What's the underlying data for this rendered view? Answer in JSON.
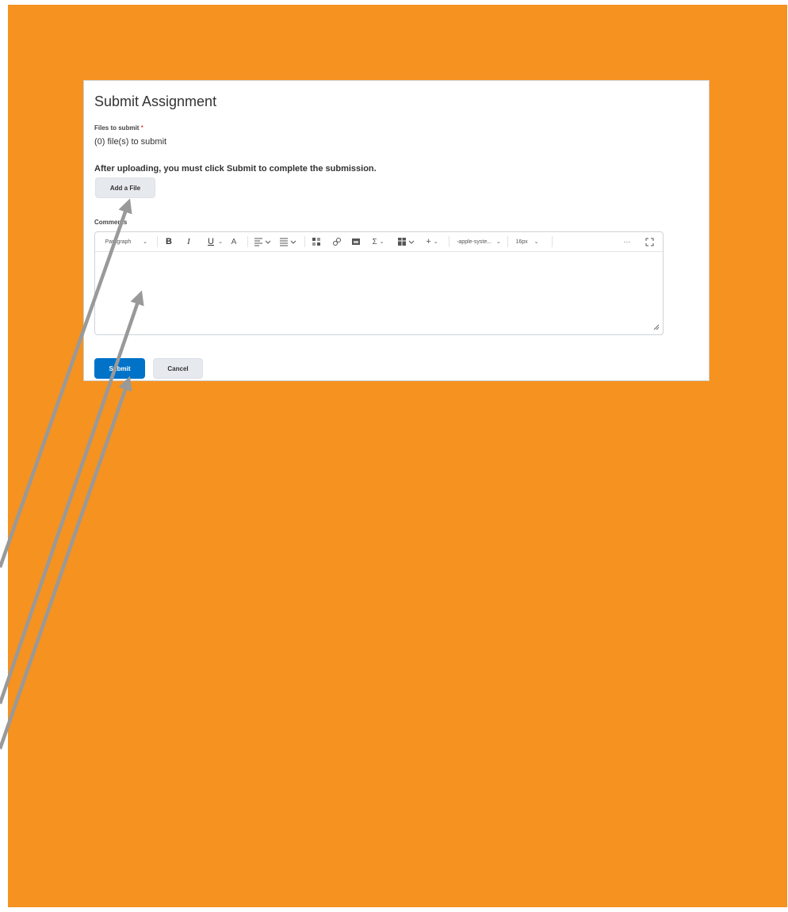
{
  "dialog": {
    "title": "Submit Assignment",
    "files_label": "Files to submit",
    "required_mark": "*",
    "files_count": "(0) file(s) to submit",
    "instructions": "After uploading, you must click Submit to complete the submission.",
    "add_file_label": "Add a File",
    "comments_label": "Comments"
  },
  "toolbar": {
    "paragraph_format": "Paragraph",
    "bold": "B",
    "italic": "I",
    "underline": "U",
    "font_family": "-apple-syste...",
    "font_size": "16px",
    "more": "···"
  },
  "actions": {
    "submit_label": "Submit",
    "cancel_label": "Cancel"
  },
  "colors": {
    "background_frame": "#F59220",
    "primary_button": "#0073C8",
    "annotation_arrow": "#999999"
  }
}
